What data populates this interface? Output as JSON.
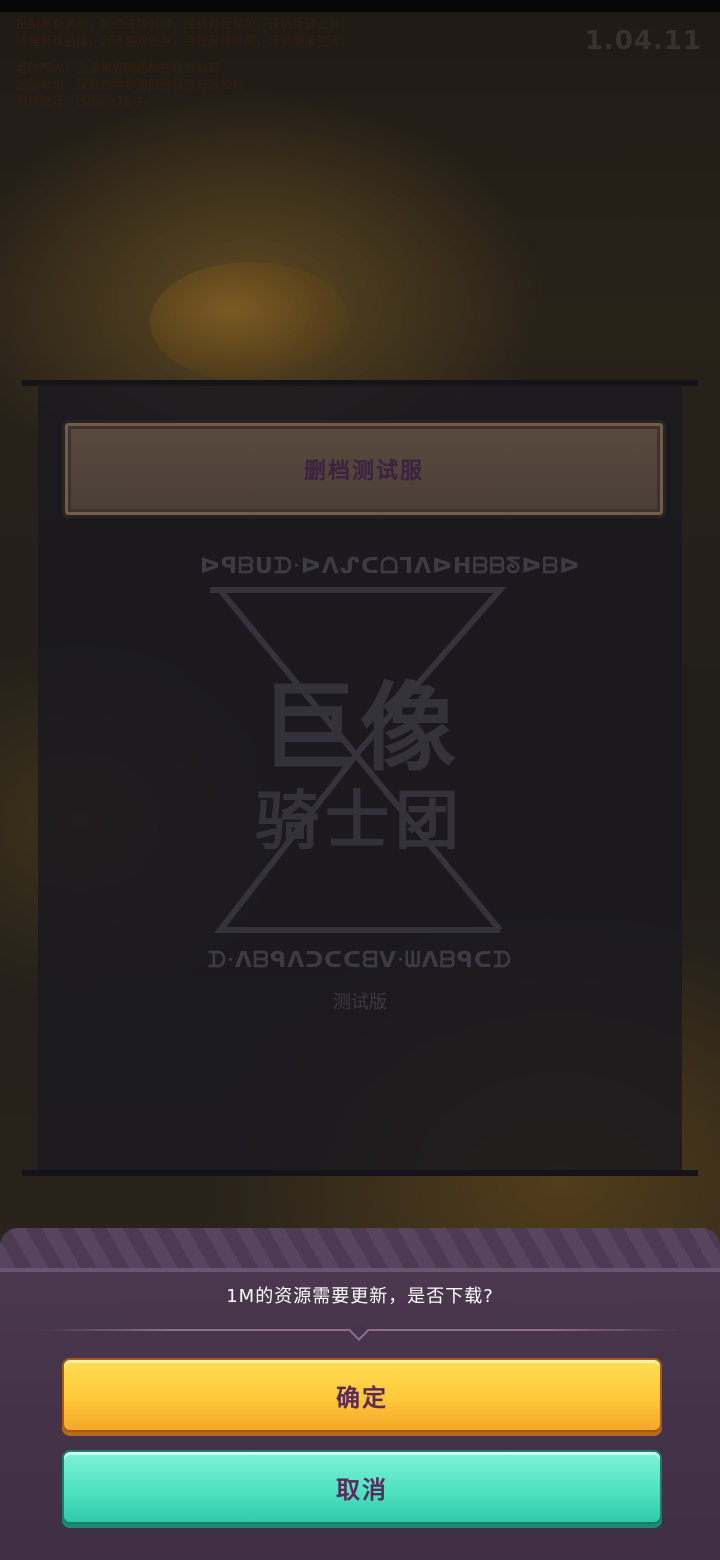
{
  "status": {
    "version": "1.04.11",
    "notice_lines": [
      "抵制不良游戏，拒绝盗版游戏。注意自我保护，谨防受骗上当。",
      "适度游戏益脑，沉迷游戏伤身。合理安排时间，享受健康生活。",
      "著作权人：上海果壳网络科技有限公司",
      "出版单位：深圳市中手游网络科技有限公司",
      "审批文号：ISBN 978-7-"
    ]
  },
  "panel": {
    "title": "删档测试服",
    "logo": {
      "rune_top": "ᐅꟼᗷᑌᗪᐧᐅᐱᔑᑕᗝᒣᐱᐅᕼᗷᗷᘕᐅᗷᐅ",
      "main": "巨像",
      "sub": "骑士团",
      "rune_bottom": "ᗪᐧᐱᗷᑫᐱᑐᑕᑕᗺᐯᐧᗯᐱᗷᑫᑕᗪ",
      "edition": "测试版"
    }
  },
  "dialog": {
    "message": "1M的资源需要更新，是否下载?",
    "confirm_label": "确定",
    "cancel_label": "取消"
  },
  "colors": {
    "confirm": "#ffc83a",
    "cancel": "#4fe3c2",
    "dialog_bg": "#46344a",
    "button_text": "#5a2a5a"
  }
}
